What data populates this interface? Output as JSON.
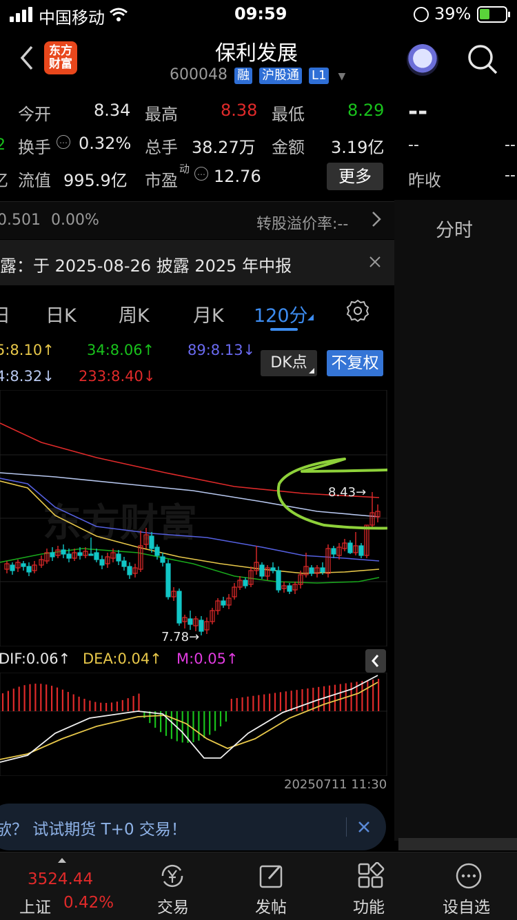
{
  "status_bar": {
    "carrier": "中国移动",
    "time": "09:59",
    "battery": "39%"
  },
  "header": {
    "title": "保利发展",
    "code": "600048",
    "tags": [
      "融",
      "沪股通",
      "L1"
    ],
    "logo": "东方\n财富"
  },
  "quote": {
    "row1": [
      {
        "label": "今开",
        "value": "8.34"
      },
      {
        "label": "最高",
        "value": "8.38"
      },
      {
        "label": "最低",
        "value": "8.29"
      }
    ],
    "row2": [
      {
        "label": "换手",
        "value": "0.32%"
      },
      {
        "label": "总手",
        "value": "38.27万"
      },
      {
        "label": "金额",
        "value": "3.19亿"
      }
    ],
    "row3": [
      {
        "label": "流值",
        "value": "995.9亿"
      },
      {
        "label": "市盈",
        "sup": "动",
        "value": "12.76"
      }
    ],
    "more_label": "更多",
    "left_edge": [
      "2",
      "亿"
    ]
  },
  "right_panel": {
    "price": "--",
    "row2_a": "--",
    "row2_b": "--",
    "row3_label": "昨收",
    "row3_b": "--",
    "tab": "分时"
  },
  "convert_row": {
    "left": "0.501",
    "pct": "0.00%",
    "right": "转股溢价率:--"
  },
  "notice": {
    "text": "露：于 2025-08-26 披露 2025 年中报"
  },
  "period_tabs": [
    {
      "label": "日"
    },
    {
      "label": "日K"
    },
    {
      "label": "周K"
    },
    {
      "label": "月K"
    },
    {
      "label": "120分",
      "active": true
    }
  ],
  "ma_legend": [
    {
      "text": "5:8.10↑",
      "color": "#e8c84a"
    },
    {
      "text": "34:8.06↑",
      "color": "#19c21c"
    },
    {
      "text": "89:8.13↓",
      "color": "#6a6af0"
    },
    {
      "text": "4:8.32↓",
      "color": "#b8c8f0"
    },
    {
      "text": "233:8.40↓",
      "color": "#e02a2a"
    }
  ],
  "chart_buttons": {
    "dk": "DK点",
    "fq": "不复权"
  },
  "chart_annotations": {
    "high": "8.43→",
    "low": "7.78→",
    "watermark": "东方财富"
  },
  "macd_legend": [
    {
      "text": "DIF:0.06↑",
      "color": "#e8e8e8"
    },
    {
      "text": "DEA:0.04↑",
      "color": "#e8c84a"
    },
    {
      "text": "M:0.05↑",
      "color": "#e13be0"
    }
  ],
  "chart_time": "20250711 11:30",
  "promo": {
    "text": "欤？ 试试期货 T+0 交易！"
  },
  "bottom_nav": {
    "index_value": "3524.44",
    "index_name": "上证",
    "index_change": "0.42%",
    "items": [
      {
        "label": "交易",
        "icon": "yen-cycle-icon"
      },
      {
        "label": "发帖",
        "icon": "edit-icon"
      },
      {
        "label": "功能",
        "icon": "grid-icon"
      },
      {
        "label": "设自选",
        "icon": "more-icon"
      }
    ]
  },
  "chart_data": {
    "type": "candlestick",
    "high_marker": 8.43,
    "low_marker": 7.78,
    "ma": {
      "ma5": 8.1,
      "ma34": 8.06,
      "ma89": 8.13,
      "ma144": 8.32,
      "ma233": 8.4
    },
    "macd": {
      "dif": 0.06,
      "dea": 0.04,
      "m": 0.05
    }
  }
}
